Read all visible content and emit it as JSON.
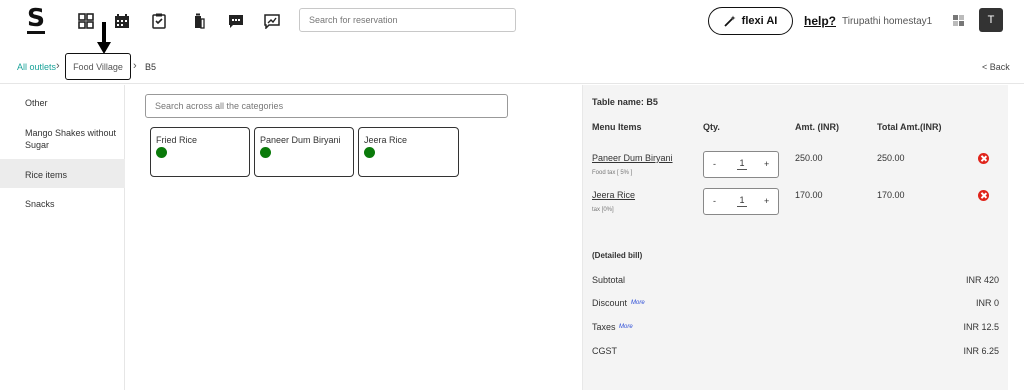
{
  "header": {
    "logo": "S",
    "search_placeholder": "Search for reservation",
    "flexi_label": "flexi AI",
    "help_label": "help?",
    "property_name": "Tirupathi homestay1",
    "avatar_initial": "T"
  },
  "breadcrumb": {
    "outlets": "All outlets",
    "sep": "›",
    "outlet": "Food Village",
    "table": "B5",
    "back": "< Back"
  },
  "sidebar": {
    "items": [
      {
        "label": "Other"
      },
      {
        "label": "Mango Shakes without"
      },
      {
        "label": "Sugar"
      },
      {
        "label": "Rice items"
      },
      {
        "label": "Snacks"
      }
    ]
  },
  "menu": {
    "search_placeholder": "Search across all the categories",
    "items": [
      {
        "name": "Fried Rice"
      },
      {
        "name": "Paneer Dum Biryani"
      },
      {
        "name": "Jeera Rice"
      }
    ]
  },
  "bill": {
    "table_name_label": "Table name:",
    "table_name": "B5",
    "columns": [
      "Menu Items",
      "Qty.",
      "Amt. (INR)",
      "Total Amt.(INR)"
    ],
    "rows": [
      {
        "item": "Paneer Dum Biryani",
        "tax": "Food tax [ 5% ]",
        "qty": "1",
        "minus": "-",
        "plus": "+",
        "amt": "250.00",
        "total": "250.00"
      },
      {
        "item": "Jeera Rice",
        "tax": "tax [0%]",
        "qty": "1",
        "minus": "-",
        "plus": "+",
        "amt": "170.00",
        "total": "170.00"
      }
    ],
    "detailed_label": "(Detailed bill)",
    "summary": [
      {
        "label": "Subtotal",
        "value": "INR 420",
        "more": ""
      },
      {
        "label": "Discount",
        "value": "INR 0",
        "more": "More"
      },
      {
        "label": "Taxes",
        "value": "INR 12.5",
        "more": "More"
      },
      {
        "label": "CGST",
        "value": "INR 6.25",
        "more": ""
      }
    ]
  },
  "colors": {
    "accent": "#1aa39a",
    "veg": "#0a7a0a",
    "delete": "#e0241b",
    "link": "#2b4cd6"
  }
}
